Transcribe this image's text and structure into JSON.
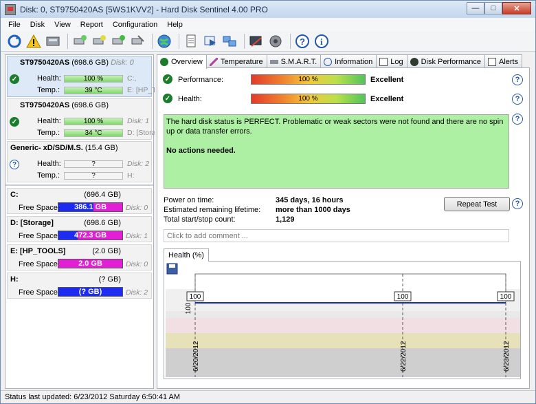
{
  "window": {
    "title": "Disk: 0, ST9750420AS [5WS1KVV2]  -  Hard Disk Sentinel 4.00 PRO"
  },
  "menu": [
    "File",
    "Disk",
    "View",
    "Report",
    "Configuration",
    "Help"
  ],
  "disks": [
    {
      "name": "ST9750420AS",
      "size": "(698.6 GB)",
      "index": "Disk: 0",
      "health_label": "Health:",
      "health": "100 %",
      "health_fraction": 1.0,
      "temp_label": "Temp.:",
      "temp": "39 °C",
      "extra1": "C:,",
      "extra2": "E: [HP_TO",
      "status": "ok"
    },
    {
      "name": "ST9750420AS",
      "size": "(698.6 GB)",
      "index": "",
      "health_label": "Health:",
      "health": "100 %",
      "health_fraction": 1.0,
      "temp_label": "Temp.:",
      "temp": "34 °C",
      "extra1": "Disk: 1",
      "extra2": "D: [Storag",
      "status": "ok"
    },
    {
      "name": "Generic- xD/SD/M.S.",
      "size": "(15.4 GB)",
      "index": "",
      "health_label": "Health:",
      "health": "?",
      "health_fraction": 0,
      "temp_label": "Temp.:",
      "temp": "?",
      "extra1": "Disk: 2",
      "extra2": "H:",
      "status": "unknown"
    }
  ],
  "partitions": [
    {
      "name": "C:",
      "size": "(696.4 GB)",
      "fs_label": "Free Space",
      "free": "386.1 GB",
      "free_fraction": 0.55,
      "disk": "Disk: 0"
    },
    {
      "name": "D: [Storage]",
      "size": "(698.6 GB)",
      "fs_label": "Free Space",
      "free": "472.3 GB",
      "free_fraction": 0.68,
      "disk": "Disk: 1"
    },
    {
      "name": "E: [HP_TOOLS]",
      "size": "(2.0 GB)",
      "fs_label": "Free Space",
      "free": "2.0 GB",
      "free_fraction": 1.0,
      "disk": "Disk: 0"
    },
    {
      "name": "H:",
      "size": "(? GB)",
      "fs_label": "Free Space",
      "free": "(? GB)",
      "free_fraction": 1.0,
      "disk": "Disk: 2"
    }
  ],
  "tabs": [
    "Overview",
    "Temperature",
    "S.M.A.R.T.",
    "Information",
    "Log",
    "Disk Performance",
    "Alerts"
  ],
  "overview": {
    "performance_label": "Performance:",
    "performance_value": "100 %",
    "performance_rating": "Excellent",
    "health_label": "Health:",
    "health_value": "100 %",
    "health_rating": "Excellent",
    "status_text": "The hard disk status is PERFECT. Problematic or weak sectors were not found and there are no spin up or data transfer errors.",
    "status_action": "No actions needed.",
    "power_on_label": "Power on time:",
    "power_on_value": "345 days, 16 hours",
    "lifetime_label": "Estimated remaining lifetime:",
    "lifetime_value": "more than 1000 days",
    "startstop_label": "Total start/stop count:",
    "startstop_value": "1,129",
    "repeat_button": "Repeat Test",
    "comment_placeholder": "Click to add comment ...",
    "graph_tab": "Health (%)"
  },
  "chart_data": {
    "type": "line",
    "title": "",
    "xlabel": "",
    "ylabel": "100",
    "x": [
      "6/20/2012",
      "6/22/2012",
      "6/23/2012"
    ],
    "series": [
      {
        "values": [
          100,
          100,
          100
        ]
      }
    ],
    "data_labels": [
      "100",
      "100",
      "100"
    ],
    "ylim": [
      0,
      100
    ],
    "grid": true
  },
  "statusbar": {
    "text": "Status last updated: 6/23/2012 Saturday 6:50:41 AM"
  },
  "colors": {
    "ok_green": "#1b7c2c",
    "status_box": "#aef0a3",
    "free_blue": "#1d2cf0",
    "free_magenta": "#e31fd6",
    "graph_line": "#1a2bb8"
  }
}
